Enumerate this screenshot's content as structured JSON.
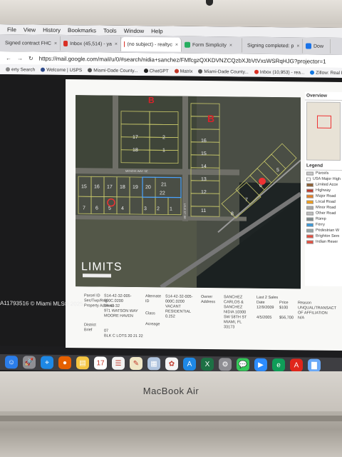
{
  "browser": {
    "menu": [
      "File",
      "View",
      "History",
      "Bookmarks",
      "Tools",
      "Window",
      "Help"
    ],
    "tabs": [
      {
        "label": "Signed contract FHC",
        "color": "#e74c3c"
      },
      {
        "label": "Inbox (45,514) - ya",
        "color": "#d93025"
      },
      {
        "label": "(no subject) - realtyc",
        "color": "#d93025",
        "active": true
      },
      {
        "label": "Form Simplicity",
        "color": "#27ae60"
      },
      {
        "label": "Signing completed: p",
        "color": "#c0392b"
      },
      {
        "label": "Dow",
        "color": "#1a73e8"
      }
    ],
    "url": "https://mail.google.com/mail/u/0/#search/nidia+sanchez/FMfcgzQXKDVNZCQzbXJbVtVxsWSRqHJG?projector=1",
    "bookmarks": [
      {
        "label": "erty Search",
        "color": "#888"
      },
      {
        "label": "Welcome | USPS",
        "color": "#2e4a8a"
      },
      {
        "label": "Miami-Dade County...",
        "color": "#555"
      },
      {
        "label": "ChatGPT",
        "color": "#222"
      },
      {
        "label": "Matrix",
        "color": "#c0392b"
      },
      {
        "label": "Miami-Dade County...",
        "color": "#555"
      },
      {
        "label": "Inbox (10,953) - rea...",
        "color": "#d93025"
      },
      {
        "label": "Zillow: Real Es",
        "color": "#1277e1"
      }
    ]
  },
  "map": {
    "labels": [
      "B",
      "B",
      "LIMITS"
    ],
    "lots_top": [
      "17",
      "2",
      "18",
      "1",
      "16",
      "15",
      "14",
      "13",
      "12",
      "11"
    ],
    "lots_mid": [
      "15",
      "16",
      "17",
      "18",
      "19",
      "20",
      "21",
      "22"
    ],
    "lots_bottom": [
      "7",
      "6",
      "5",
      "4",
      "3",
      "2",
      "1"
    ],
    "lots_right": [
      "8",
      "7",
      "6",
      "5",
      "4",
      "3",
      "2",
      "1"
    ],
    "streets": [
      "MENDIS WAY SE",
      "LYLE ST SE"
    ]
  },
  "legend": {
    "overview_title": "Overview",
    "legend_title": "Legend",
    "items": [
      {
        "label": "Parcels",
        "color": "#c9c9c9"
      },
      {
        "label": "USA Major High",
        "color": "#ffffff"
      },
      {
        "label": "Limited Acce",
        "color": "#8b5a2b"
      },
      {
        "label": "Highway",
        "color": "#c0392b"
      },
      {
        "label": "Major Road",
        "color": "#e67e22"
      },
      {
        "label": "Local Road",
        "color": "#f39c12"
      },
      {
        "label": "Minor Road",
        "color": "#a9a9a9"
      },
      {
        "label": "Other Road",
        "color": "#bdbdbd"
      },
      {
        "label": "Ramp",
        "color": "#7f8c8d"
      },
      {
        "label": "Ferry",
        "color": "#3498db"
      },
      {
        "label": "Pedestrian W",
        "color": "#95a5a6"
      },
      {
        "label": "Brighton Sem",
        "color": "#e74c3c"
      },
      {
        "label": "Indian Reser",
        "color": "#e74c3c"
      }
    ]
  },
  "parcel": {
    "parcel_id_label": "Parcel ID",
    "parcel_id": "S14-42-32-005-000C.0200",
    "sec_label": "Sec/Twp/Rng",
    "sec": "14-42-32",
    "property_label": "Property Address",
    "property": "971 WATSON WAY MOORE HAVEN",
    "alternate_label": "Alternate ID",
    "alternate": "S14-42-32-005-000C.0200",
    "class_label": "Class",
    "class": "VACANT RESIDENTIAL",
    "acreage_label": "Acreage",
    "acreage": "0.252",
    "owner_label": "Owner Address",
    "owner": "SANCHEZ CARLOS & SANCHEZ NIDIA 10300 SW 58TH ST MIAMI, FL 33173",
    "sales_title": "Last 2 Sales",
    "sales_headers": [
      "Date",
      "Price",
      "Reason"
    ],
    "sales": [
      [
        "12/9/2009",
        "$100",
        "UNQUAL/TRANSACT OF AFFILIATION"
      ],
      [
        "4/5/2005",
        "$56,700",
        "N/A"
      ]
    ],
    "district_label": "District",
    "district": "07",
    "brief_label": "Brief",
    "brief": "BLK C LOTS 20 21 22"
  },
  "watermark": "A11793516 © Miami MLS® 2025",
  "brand": "MacBook Air",
  "dock_icons": [
    {
      "name": "finder",
      "color": "#2b7de9",
      "glyph": "☺"
    },
    {
      "name": "launchpad",
      "color": "#8e8e93",
      "glyph": "🚀"
    },
    {
      "name": "safari",
      "color": "#1e88e5",
      "glyph": "⌖"
    },
    {
      "name": "firefox",
      "color": "#e66000",
      "glyph": "●"
    },
    {
      "name": "notes",
      "color": "#f5c542",
      "glyph": "▤"
    },
    {
      "name": "calendar",
      "color": "#ffffff",
      "glyph": "17"
    },
    {
      "name": "reminders",
      "color": "#f2f2f2",
      "glyph": "☰"
    },
    {
      "name": "notes2",
      "color": "#f0e7c7",
      "glyph": "✎"
    },
    {
      "name": "preview",
      "color": "#b0c4de",
      "glyph": "▦"
    },
    {
      "name": "photos",
      "color": "#f4f4f4",
      "glyph": "✿"
    },
    {
      "name": "appstore",
      "color": "#1e88e5",
      "glyph": "A"
    },
    {
      "name": "excel",
      "color": "#1d7044",
      "glyph": "X"
    },
    {
      "name": "settings",
      "color": "#8e8e93",
      "glyph": "⚙"
    },
    {
      "name": "messages",
      "color": "#34c759",
      "glyph": "💬"
    },
    {
      "name": "zoom",
      "color": "#2d8cff",
      "glyph": "▶"
    },
    {
      "name": "edge",
      "color": "#0f9d58",
      "glyph": "e"
    },
    {
      "name": "acrobat",
      "color": "#e0261b",
      "glyph": "A"
    },
    {
      "name": "folder",
      "color": "#6aa9f7",
      "glyph": "▇"
    }
  ]
}
